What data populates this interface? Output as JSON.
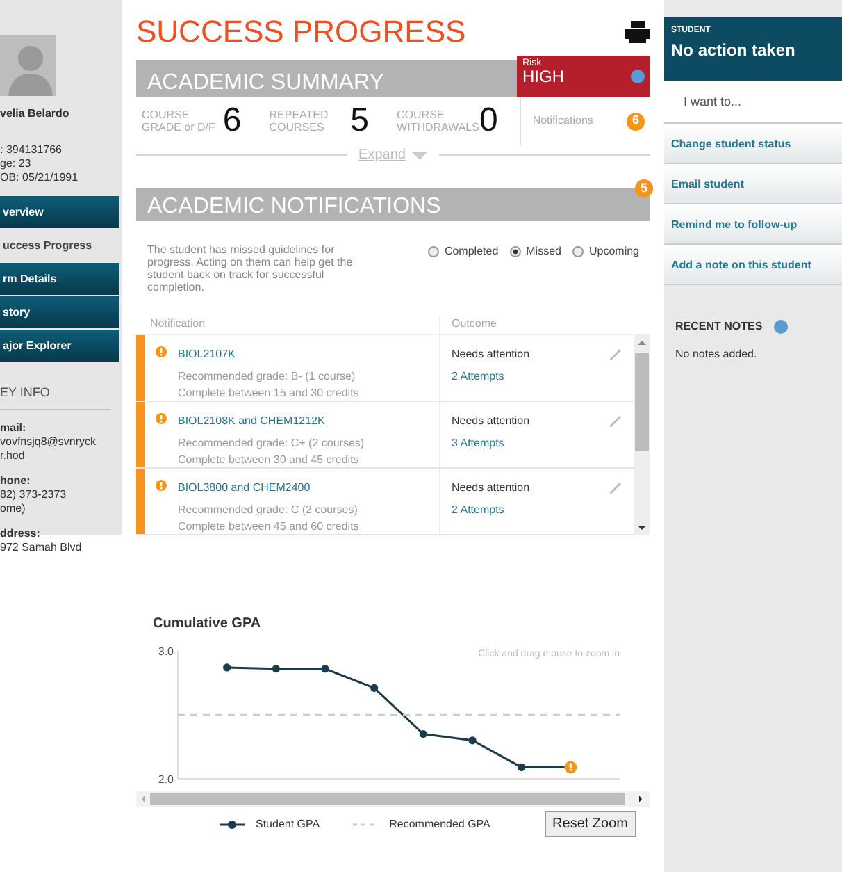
{
  "profile": {
    "name": "velia Belardo",
    "details": [
      ": 394131766",
      "ge: 23",
      "OB: 05/21/1991"
    ]
  },
  "nav": [
    {
      "label": "verview",
      "selected": false
    },
    {
      "label": "uccess Progress",
      "selected": true
    },
    {
      "label": "rm Details",
      "selected": false
    },
    {
      "label": "story",
      "selected": false
    },
    {
      "label": "ajor Explorer",
      "selected": false
    }
  ],
  "key_info": {
    "heading": "EY INFO",
    "fields": [
      {
        "label": "mail:",
        "lines": [
          "vovfnsjq8@svnryck",
          "r.hod"
        ]
      },
      {
        "label": "hone:",
        "lines": [
          "82) 373-2373",
          "ome)"
        ]
      },
      {
        "label": "ddress:",
        "lines": [
          "972 Samah Blvd"
        ]
      }
    ]
  },
  "page_title": "SUCCESS PROGRESS",
  "summary": {
    "title": "ACADEMIC SUMMARY",
    "risk_label": "Risk",
    "risk_level": "HIGH",
    "stats": [
      {
        "label": "COURSE GRADE or D/F",
        "value": "6"
      },
      {
        "label": "REPEATED COURSES",
        "value": "5"
      },
      {
        "label": "COURSE WITHDRAWALS",
        "value": "0"
      }
    ],
    "notifications_label": "Notifications",
    "notifications_count": "6",
    "expand": "Expand"
  },
  "notifications": {
    "title": "ACADEMIC NOTIFICATIONS",
    "count": "5",
    "description": "The student has missed guidelines for progress. Acting on them can help get the student back on track for successful completion.",
    "filters": [
      {
        "label": "Completed",
        "selected": false
      },
      {
        "label": "Missed",
        "selected": true
      },
      {
        "label": "Upcoming",
        "selected": false
      }
    ],
    "columns": [
      "Notification",
      "Outcome"
    ],
    "rows": [
      {
        "course": "BIOL2107K",
        "grade": "Recommended grade: B- (1 course)",
        "credits": "Complete between 15 and 30 credits",
        "outcome": "Needs attention",
        "attempts": "2 Attempts"
      },
      {
        "course": "BIOL2108K and CHEM1212K",
        "grade": "Recommended grade: C+ (2 courses)",
        "credits": "Complete between 30 and 45 credits",
        "outcome": "Needs attention",
        "attempts": "3 Attempts"
      },
      {
        "course": "BIOL3800 and CHEM2400",
        "grade": "Recommended grade: C (2 courses)",
        "credits": "Complete between 45 and 60 credits",
        "outcome": "Needs attention",
        "attempts": "2 Attempts"
      }
    ]
  },
  "gpa_chart": {
    "hint": "Click and drag mouse to zoom in",
    "reset_button": "Reset Zoom",
    "chart_data": {
      "type": "line",
      "title": "Cumulative GPA",
      "ylim": [
        2.0,
        3.0
      ],
      "yticks": [
        {
          "value": 2.0,
          "label": "2.0"
        },
        {
          "value": 3.0,
          "label": "3.0"
        }
      ],
      "series": [
        {
          "name": "Student GPA",
          "color": "#1b3a4b",
          "marker": "circle",
          "values": [
            null,
            2.87,
            2.86,
            2.86,
            2.71,
            2.35,
            2.3,
            2.09,
            2.09,
            null
          ]
        },
        {
          "name": "Recommended GPA",
          "color": "#cccccc",
          "line_style": "dashed",
          "values": [
            2.5,
            2.5,
            2.5,
            2.5,
            2.5,
            2.5,
            2.5,
            2.5,
            2.5,
            2.5
          ]
        }
      ]
    }
  },
  "student_panel": {
    "label": "STUDENT",
    "status": "No action taken",
    "prompt": "I want to...",
    "actions": [
      "Change student status",
      "Email student",
      "Remind me to follow-up",
      "Add a note on this student"
    ],
    "notes_heading": "RECENT NOTES",
    "notes_empty": "No notes added."
  }
}
